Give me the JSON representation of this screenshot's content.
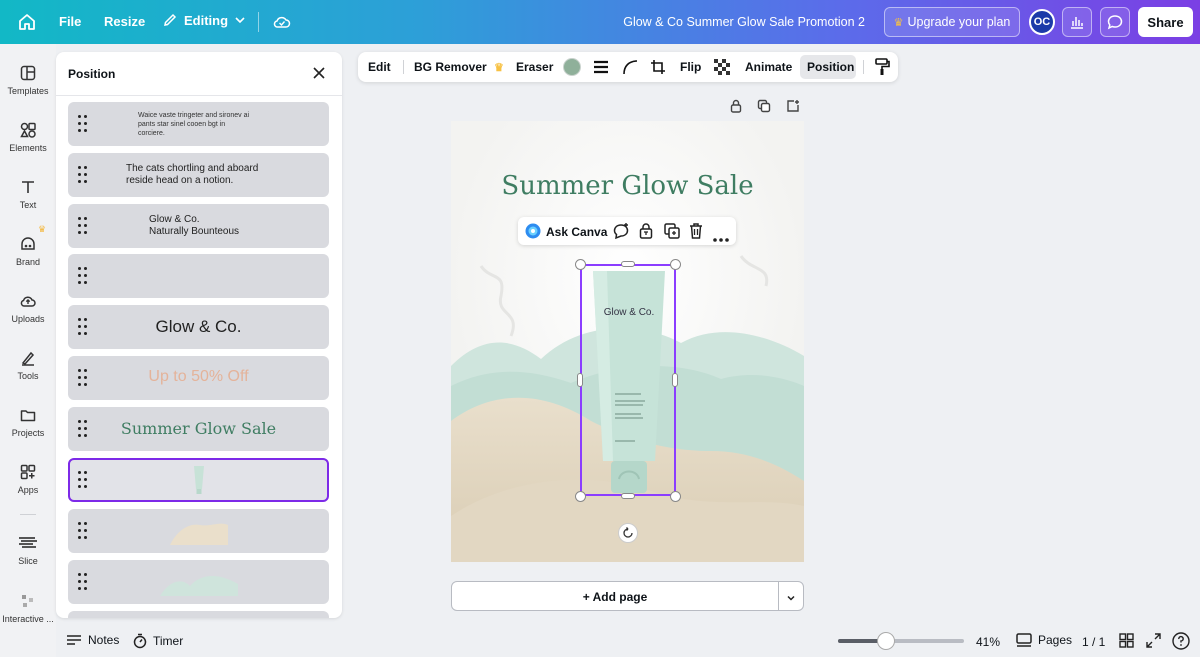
{
  "topbar": {
    "file": "File",
    "resize": "Resize",
    "editing": "Editing",
    "document_title": "Glow & Co Summer Glow Sale Promotion 2",
    "upgrade": "Upgrade your plan",
    "avatar_initials": "OC",
    "share": "Share"
  },
  "rail": {
    "templates": "Templates",
    "elements": "Elements",
    "text": "Text",
    "brand": "Brand",
    "uploads": "Uploads",
    "tools": "Tools",
    "projects": "Projects",
    "apps": "Apps",
    "slice": "Slice",
    "interactive": "Interactive ..."
  },
  "panel": {
    "title": "Position",
    "layers": [
      {
        "text": "Waice vaste tringeter and sironev ai\npants star sinel cooen bgt in\ncorciere."
      },
      {
        "text": "The cats chortling and aboard\nreside head on a notion."
      },
      {
        "text": "Glow & Co.\nNaturally Bounteous"
      },
      {
        "text": ""
      },
      {
        "text": "Glow & Co."
      },
      {
        "text": "Up to 50% Off"
      },
      {
        "text": "Summer Glow Sale"
      },
      {
        "text": ""
      },
      {
        "text": ""
      },
      {
        "text": ""
      }
    ]
  },
  "toolbar": {
    "edit": "Edit",
    "bg_remover": "BG Remover",
    "eraser": "Eraser",
    "flip": "Flip",
    "animate": "Animate",
    "position": "Position"
  },
  "canvas": {
    "headline": "Summer Glow Sale",
    "tube_brand": "Glow & Co.",
    "ask_canva": "Ask Canva",
    "add_page": "+ Add page"
  },
  "bottombar": {
    "notes": "Notes",
    "timer": "Timer",
    "zoom": "41%",
    "zoom_fraction": 0.38,
    "pages": "Pages",
    "page_count": "1 / 1"
  },
  "colors": {
    "accent": "#7d2ae8",
    "headline_green": "#3f7d62",
    "discount_peach": "#e4b39a"
  }
}
